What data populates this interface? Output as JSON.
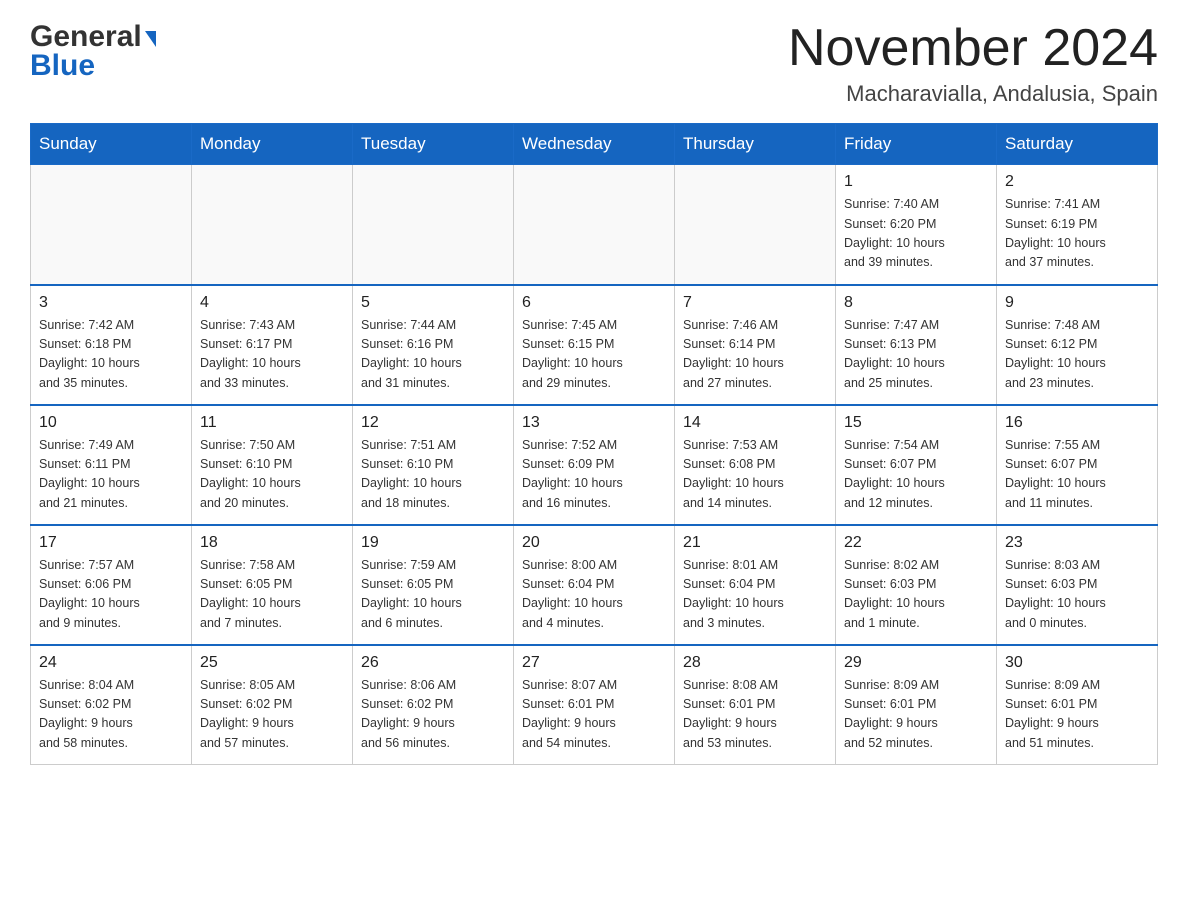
{
  "header": {
    "logo_general": "General",
    "logo_blue": "Blue",
    "title": "November 2024",
    "subtitle": "Macharavialla, Andalusia, Spain"
  },
  "days_of_week": [
    "Sunday",
    "Monday",
    "Tuesday",
    "Wednesday",
    "Thursday",
    "Friday",
    "Saturday"
  ],
  "weeks": [
    [
      {
        "day": "",
        "info": ""
      },
      {
        "day": "",
        "info": ""
      },
      {
        "day": "",
        "info": ""
      },
      {
        "day": "",
        "info": ""
      },
      {
        "day": "",
        "info": ""
      },
      {
        "day": "1",
        "info": "Sunrise: 7:40 AM\nSunset: 6:20 PM\nDaylight: 10 hours\nand 39 minutes."
      },
      {
        "day": "2",
        "info": "Sunrise: 7:41 AM\nSunset: 6:19 PM\nDaylight: 10 hours\nand 37 minutes."
      }
    ],
    [
      {
        "day": "3",
        "info": "Sunrise: 7:42 AM\nSunset: 6:18 PM\nDaylight: 10 hours\nand 35 minutes."
      },
      {
        "day": "4",
        "info": "Sunrise: 7:43 AM\nSunset: 6:17 PM\nDaylight: 10 hours\nand 33 minutes."
      },
      {
        "day": "5",
        "info": "Sunrise: 7:44 AM\nSunset: 6:16 PM\nDaylight: 10 hours\nand 31 minutes."
      },
      {
        "day": "6",
        "info": "Sunrise: 7:45 AM\nSunset: 6:15 PM\nDaylight: 10 hours\nand 29 minutes."
      },
      {
        "day": "7",
        "info": "Sunrise: 7:46 AM\nSunset: 6:14 PM\nDaylight: 10 hours\nand 27 minutes."
      },
      {
        "day": "8",
        "info": "Sunrise: 7:47 AM\nSunset: 6:13 PM\nDaylight: 10 hours\nand 25 minutes."
      },
      {
        "day": "9",
        "info": "Sunrise: 7:48 AM\nSunset: 6:12 PM\nDaylight: 10 hours\nand 23 minutes."
      }
    ],
    [
      {
        "day": "10",
        "info": "Sunrise: 7:49 AM\nSunset: 6:11 PM\nDaylight: 10 hours\nand 21 minutes."
      },
      {
        "day": "11",
        "info": "Sunrise: 7:50 AM\nSunset: 6:10 PM\nDaylight: 10 hours\nand 20 minutes."
      },
      {
        "day": "12",
        "info": "Sunrise: 7:51 AM\nSunset: 6:10 PM\nDaylight: 10 hours\nand 18 minutes."
      },
      {
        "day": "13",
        "info": "Sunrise: 7:52 AM\nSunset: 6:09 PM\nDaylight: 10 hours\nand 16 minutes."
      },
      {
        "day": "14",
        "info": "Sunrise: 7:53 AM\nSunset: 6:08 PM\nDaylight: 10 hours\nand 14 minutes."
      },
      {
        "day": "15",
        "info": "Sunrise: 7:54 AM\nSunset: 6:07 PM\nDaylight: 10 hours\nand 12 minutes."
      },
      {
        "day": "16",
        "info": "Sunrise: 7:55 AM\nSunset: 6:07 PM\nDaylight: 10 hours\nand 11 minutes."
      }
    ],
    [
      {
        "day": "17",
        "info": "Sunrise: 7:57 AM\nSunset: 6:06 PM\nDaylight: 10 hours\nand 9 minutes."
      },
      {
        "day": "18",
        "info": "Sunrise: 7:58 AM\nSunset: 6:05 PM\nDaylight: 10 hours\nand 7 minutes."
      },
      {
        "day": "19",
        "info": "Sunrise: 7:59 AM\nSunset: 6:05 PM\nDaylight: 10 hours\nand 6 minutes."
      },
      {
        "day": "20",
        "info": "Sunrise: 8:00 AM\nSunset: 6:04 PM\nDaylight: 10 hours\nand 4 minutes."
      },
      {
        "day": "21",
        "info": "Sunrise: 8:01 AM\nSunset: 6:04 PM\nDaylight: 10 hours\nand 3 minutes."
      },
      {
        "day": "22",
        "info": "Sunrise: 8:02 AM\nSunset: 6:03 PM\nDaylight: 10 hours\nand 1 minute."
      },
      {
        "day": "23",
        "info": "Sunrise: 8:03 AM\nSunset: 6:03 PM\nDaylight: 10 hours\nand 0 minutes."
      }
    ],
    [
      {
        "day": "24",
        "info": "Sunrise: 8:04 AM\nSunset: 6:02 PM\nDaylight: 9 hours\nand 58 minutes."
      },
      {
        "day": "25",
        "info": "Sunrise: 8:05 AM\nSunset: 6:02 PM\nDaylight: 9 hours\nand 57 minutes."
      },
      {
        "day": "26",
        "info": "Sunrise: 8:06 AM\nSunset: 6:02 PM\nDaylight: 9 hours\nand 56 minutes."
      },
      {
        "day": "27",
        "info": "Sunrise: 8:07 AM\nSunset: 6:01 PM\nDaylight: 9 hours\nand 54 minutes."
      },
      {
        "day": "28",
        "info": "Sunrise: 8:08 AM\nSunset: 6:01 PM\nDaylight: 9 hours\nand 53 minutes."
      },
      {
        "day": "29",
        "info": "Sunrise: 8:09 AM\nSunset: 6:01 PM\nDaylight: 9 hours\nand 52 minutes."
      },
      {
        "day": "30",
        "info": "Sunrise: 8:09 AM\nSunset: 6:01 PM\nDaylight: 9 hours\nand 51 minutes."
      }
    ]
  ]
}
